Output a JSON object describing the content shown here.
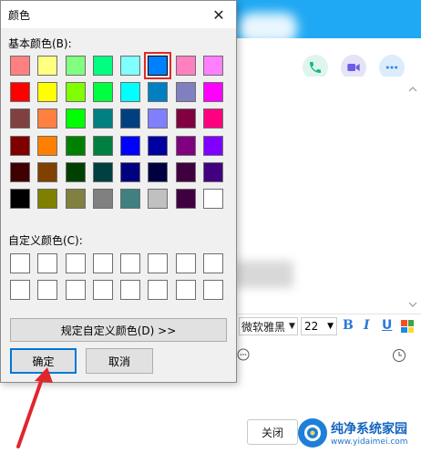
{
  "dialog": {
    "title": "颜色",
    "close_glyph": "✕",
    "basic_colors_label": "基本颜色(B):",
    "custom_colors_label": "自定义颜色(C):",
    "define_custom_label": "规定自定义颜色(D) >>",
    "ok_label": "确定",
    "cancel_label": "取消",
    "basic_colors": [
      "#ff8080",
      "#ffff80",
      "#80ff80",
      "#00ff80",
      "#80ffff",
      "#0080ff",
      "#ff80c0",
      "#ff80ff",
      "#ff0000",
      "#ffff00",
      "#80ff00",
      "#00ff40",
      "#00ffff",
      "#0080c0",
      "#8080c0",
      "#ff00ff",
      "#804040",
      "#ff8040",
      "#00ff00",
      "#008080",
      "#004080",
      "#8080ff",
      "#800040",
      "#ff0080",
      "#800000",
      "#ff8000",
      "#008000",
      "#008040",
      "#0000ff",
      "#0000a0",
      "#800080",
      "#8000ff",
      "#400000",
      "#804000",
      "#004000",
      "#004040",
      "#000080",
      "#000040",
      "#400040",
      "#400080",
      "#000000",
      "#808000",
      "#808040",
      "#808080",
      "#408080",
      "#c0c0c0",
      "#400040",
      "#ffffff"
    ],
    "selected_index": 5
  },
  "chat": {
    "font_name": "微软雅黑",
    "font_size": "22",
    "bold_label": "B",
    "italic_label": "I",
    "underline_label": "U",
    "close_label": "关闭",
    "watermark_title": "纯净系统家园",
    "watermark_url": "www.yidaimei.com"
  },
  "colors": {
    "header_blue": "#1fa8f3",
    "ok_border": "#0078d7",
    "annotation_red": "#e0262b"
  }
}
